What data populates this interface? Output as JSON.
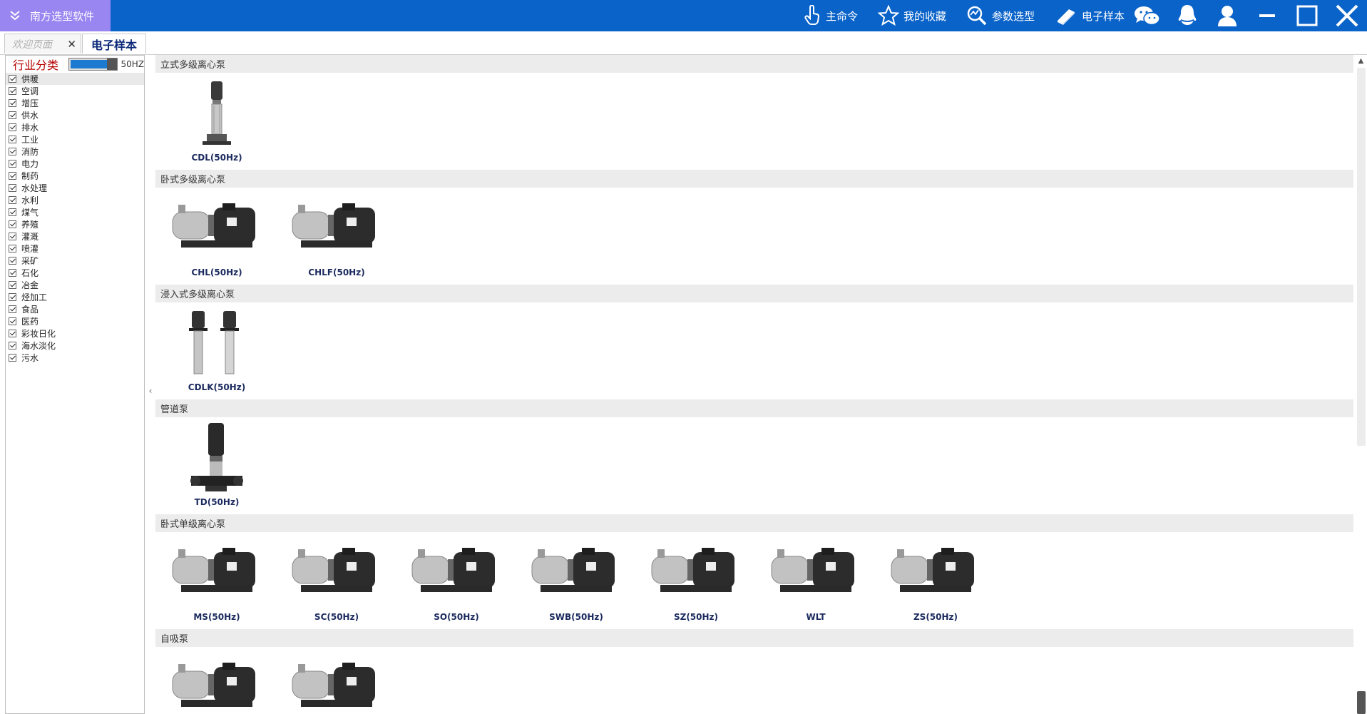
{
  "app": {
    "title": "南方选型软件",
    "toolbar": [
      {
        "label": "主命令",
        "icon": "hand-pointer-icon"
      },
      {
        "label": "我的收藏",
        "icon": "star-icon"
      },
      {
        "label": "参数选型",
        "icon": "magnifier-chart-icon"
      },
      {
        "label": "电子样本",
        "icon": "book-icon"
      }
    ],
    "window_icons": [
      "wechat-icon",
      "qq-icon",
      "user-icon",
      "minimize-icon",
      "maximize-icon",
      "close-icon"
    ],
    "accent_color": "#0a63c9"
  },
  "tabs": [
    {
      "label": "欢迎页面",
      "closable": true
    },
    {
      "label": "电子样本",
      "active": true
    }
  ],
  "sidebar": {
    "title": "行业分类",
    "frequency": "50HZ",
    "categories": [
      "供暖",
      "空调",
      "增压",
      "供水",
      "排水",
      "工业",
      "消防",
      "电力",
      "制药",
      "水处理",
      "水利",
      "煤气",
      "养殖",
      "灌溉",
      "喷灌",
      "采矿",
      "石化",
      "冶金",
      "烃加工",
      "食品",
      "医药",
      "彩妆日化",
      "海水淡化",
      "污水"
    ]
  },
  "sections": [
    {
      "title": "立式多级离心泵",
      "products": [
        "CDL(50Hz)"
      ]
    },
    {
      "title": "卧式多级离心泵",
      "products": [
        "CHL(50Hz)",
        "CHLF(50Hz)"
      ]
    },
    {
      "title": "浸入式多级离心泵",
      "products": [
        "CDLK(50Hz)"
      ]
    },
    {
      "title": "管道泵",
      "products": [
        "TD(50Hz)"
      ]
    },
    {
      "title": "卧式单级离心泵",
      "products": [
        "MS(50Hz)",
        "SC(50Hz)",
        "SO(50Hz)",
        "SWB(50Hz)",
        "SZ(50Hz)",
        "WLT",
        "ZS(50Hz)"
      ]
    },
    {
      "title": "自吸泵",
      "products": [
        "",
        ""
      ]
    }
  ]
}
